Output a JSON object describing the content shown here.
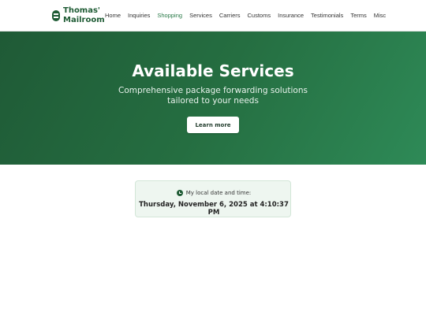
{
  "header": {
    "logo_line1": "Thomas'",
    "logo_line2": "Mailroom",
    "logo_icon": "mailbox-icon",
    "nav": [
      {
        "label": "Home",
        "active": false
      },
      {
        "label": "Inquiries",
        "active": false
      },
      {
        "label": "Shopping",
        "active": true
      },
      {
        "label": "Services",
        "active": false
      },
      {
        "label": "Carriers",
        "active": false
      },
      {
        "label": "Customs",
        "active": false
      },
      {
        "label": "Insurance",
        "active": false
      },
      {
        "label": "Testimonials",
        "active": false
      },
      {
        "label": "Terms",
        "active": false
      },
      {
        "label": "Misc",
        "active": false
      }
    ]
  },
  "hero": {
    "title": "Available Services",
    "subtitle": "Comprehensive package forwarding solutions tailored to your needs",
    "button_label": "Learn more"
  },
  "time_card": {
    "label": "My local date and time:",
    "value": "Thursday, November 6, 2025 at 4:10:37 PM",
    "icon": "clock-icon"
  },
  "colors": {
    "brand": "#1e5b34",
    "active_nav": "#2a7a48",
    "hero_start": "#1f5a36",
    "hero_end": "#2e8a57",
    "card_bg": "#eef6f0"
  }
}
